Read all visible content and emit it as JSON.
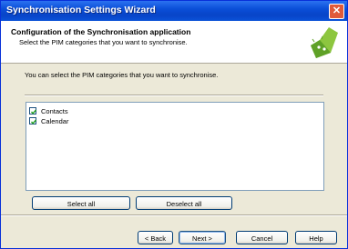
{
  "window": {
    "title": "Synchronisation Settings Wizard",
    "close_icon": "close-icon"
  },
  "header": {
    "title": "Configuration of the Synchronisation application",
    "subtitle": "Select the PIM categories that you want to synchronise.",
    "logo_icon": "android-logo-icon"
  },
  "main": {
    "instruction": "You can select the PIM categories that you want to synchronise.",
    "categories": [
      {
        "label": "Contacts",
        "checked": true
      },
      {
        "label": "Calendar",
        "checked": true
      }
    ],
    "select_all_label": "Select all",
    "deselect_all_label": "Deselect all"
  },
  "footer": {
    "back_label": "< Back",
    "next_label": "Next >",
    "cancel_label": "Cancel",
    "help_label": "Help"
  },
  "colors": {
    "title_bar": "#0a4fd8",
    "accent_green": "#8dc63f",
    "face": "#ece9d8"
  }
}
